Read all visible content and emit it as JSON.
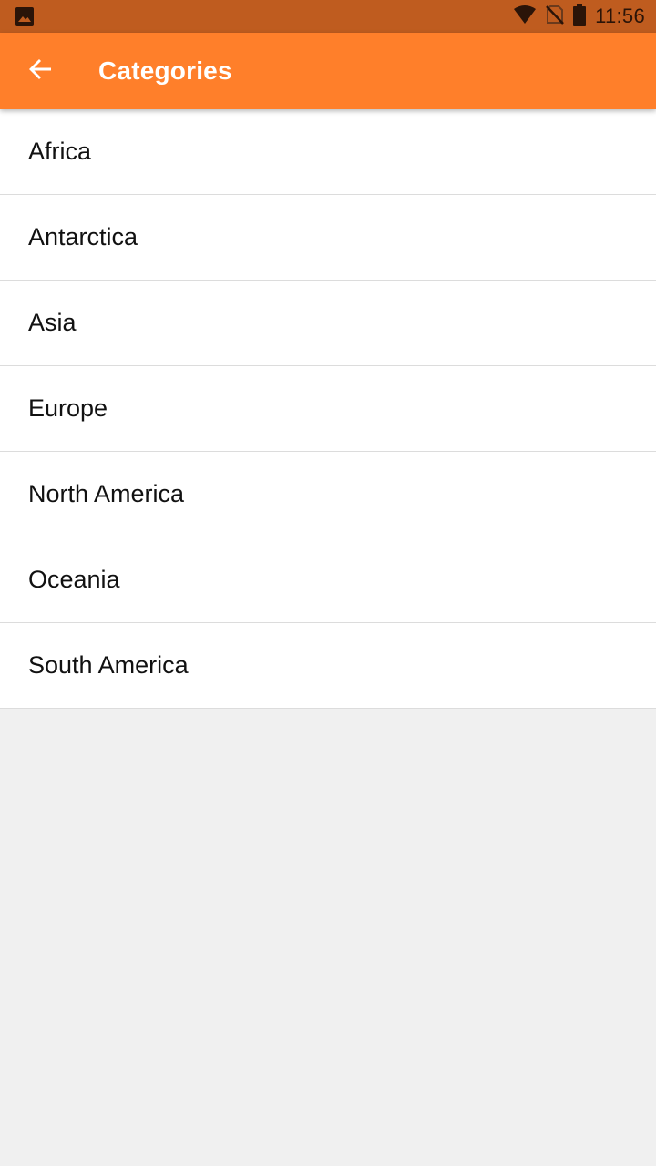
{
  "status_bar": {
    "time": "11:56",
    "icons": [
      "image-icon",
      "wifi-icon",
      "no-sim-icon",
      "battery-icon"
    ]
  },
  "app_bar": {
    "title": "Categories",
    "back_icon": "arrow-back-icon",
    "color": "#ff7f2a"
  },
  "categories": [
    {
      "label": "Africa"
    },
    {
      "label": "Antarctica"
    },
    {
      "label": "Asia"
    },
    {
      "label": "Europe"
    },
    {
      "label": "North America"
    },
    {
      "label": "Oceania"
    },
    {
      "label": "South America"
    }
  ]
}
